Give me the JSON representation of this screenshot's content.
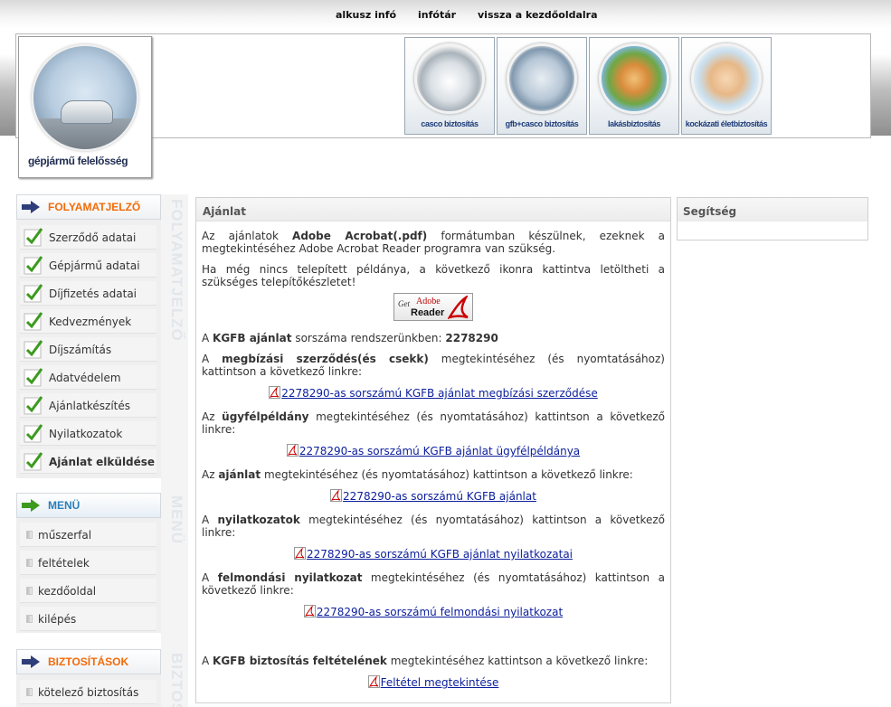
{
  "topnav": {
    "items": [
      "alkusz infó",
      "infótár",
      "vissza a kezdőoldalra"
    ]
  },
  "logo": {
    "label": "gépjármű felelősség"
  },
  "products": [
    {
      "label": "casco biztosítás"
    },
    {
      "label": "gfb+casco biztosítás"
    },
    {
      "label": "lakásbiztosítás"
    },
    {
      "label": "kockázati életbiztosítás"
    }
  ],
  "progress": {
    "title": "FOLYAMATJELZŐ",
    "vertical": "FOLYAMATJELZŐ",
    "items": [
      "Szerződő adatai",
      "Gépjármű adatai",
      "Díjfizetés adatai",
      "Kedvezmények",
      "Díjszámítás",
      "Adatvédelem",
      "Ajánlatkészítés",
      "Nyilatkozatok",
      "Ajánlat elküldése"
    ]
  },
  "menu": {
    "title": "MENÜ",
    "vertical": "MENÜ",
    "items": [
      "műszerfal",
      "feltételek",
      "kezdőoldal",
      "kilépés"
    ]
  },
  "insurances": {
    "title": "BIZTOSÍTÁSOK",
    "vertical": "BIZTOS",
    "items": [
      "kötelező biztosítás"
    ]
  },
  "main": {
    "title": "Ajánlat",
    "p1_a": "Az ajánlatok ",
    "p1_b": "Adobe Acrobat(.pdf)",
    "p1_c": " formátumban készülnek, ezeknek a megtekintéséhez Adobe Acrobat Reader programra van szükség.",
    "p2": "Ha még nincs telepített példánya, a következő ikonra kattintva letöltheti a szükséges telepítőkészletet!",
    "adobe": {
      "get": "Get",
      "brand": "Adobe",
      "reader": "Reader"
    },
    "p3_a": "A ",
    "p3_b": "KGFB ajánlat",
    "p3_c": " sorszáma rendszerünkben: ",
    "p3_d": "2278290",
    "p4_a": "A ",
    "p4_b": "megbízási szerződés(és csekk)",
    "p4_c": " megtekintéséhez (és nyomtatásához) kattintson a következő linkre:",
    "link1": "2278290-as sorszámú KGFB ajánlat megbízási szerződése",
    "p5_a": "Az ",
    "p5_b": "ügyfélpéldány",
    "p5_c": " megtekintéséhez (és nyomtatásához) kattintson a következő linkre:",
    "link2": "2278290-as sorszámú KGFB ajánlat ügyfélpéldánya",
    "p6_a": "Az ",
    "p6_b": "ajánlat",
    "p6_c": " megtekintéséhez (és nyomtatásához) kattintson a következő linkre:",
    "link3": "2278290-as sorszámú KGFB ajánlat",
    "p7_a": "A ",
    "p7_b": "nyilatkozatok",
    "p7_c": " megtekintéséhez (és nyomtatásához) kattintson a következő linkre:",
    "link4": "2278290-as sorszámú KGFB ajánlat nyilatkozatai",
    "p8_a": "A ",
    "p8_b": "felmondási nyilatkozat",
    "p8_c": " megtekintéséhez (és nyomtatásához) kattintson a következő linkre:",
    "link5": "2278290-as sorszámú felmondási nyilatkozat",
    "p9_a": "A ",
    "p9_b": "KGFB biztosítás feltételének",
    "p9_c": " megtekintéséhez kattintson a következő linkre:",
    "link6": "Feltétel megtekintése"
  },
  "help": {
    "title": "Segítség"
  },
  "colors": {
    "accent": "#f26b0a",
    "menu_accent": "#2a7fb8",
    "link": "#0b1e9c",
    "check": "#3c9a1e"
  }
}
